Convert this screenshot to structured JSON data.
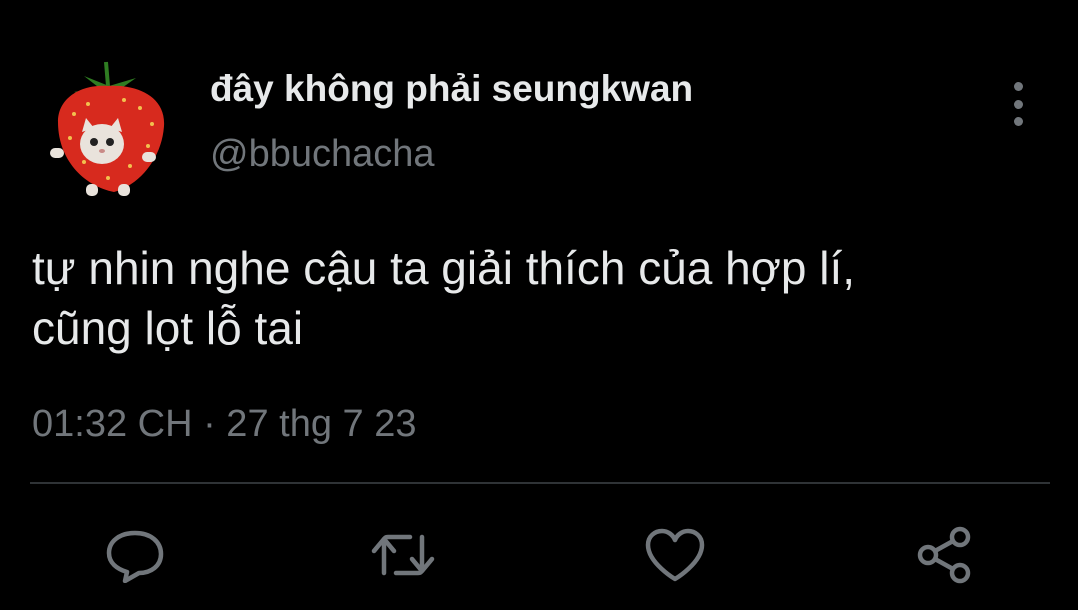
{
  "tweet": {
    "display_name": "đây không phải seungkwan",
    "handle": "@bbuchacha",
    "text_line1": "tự nhin nghe cậu ta giải thích của hợp lí,",
    "text_line2": "cũng lọt lỗ tai",
    "timestamp": "01:32 CH · 27 thg 7 23"
  },
  "icons": {
    "avatar": "strawberry-cat-avatar",
    "more": "more-vertical-icon",
    "reply": "reply-icon",
    "retweet": "retweet-icon",
    "like": "heart-icon",
    "share": "share-icon"
  },
  "colors": {
    "background": "#000000",
    "primary_text": "#e7e9ea",
    "secondary_text": "#71767b",
    "divider": "#2f3336",
    "avatar_strawberry": "#d72a1e"
  }
}
